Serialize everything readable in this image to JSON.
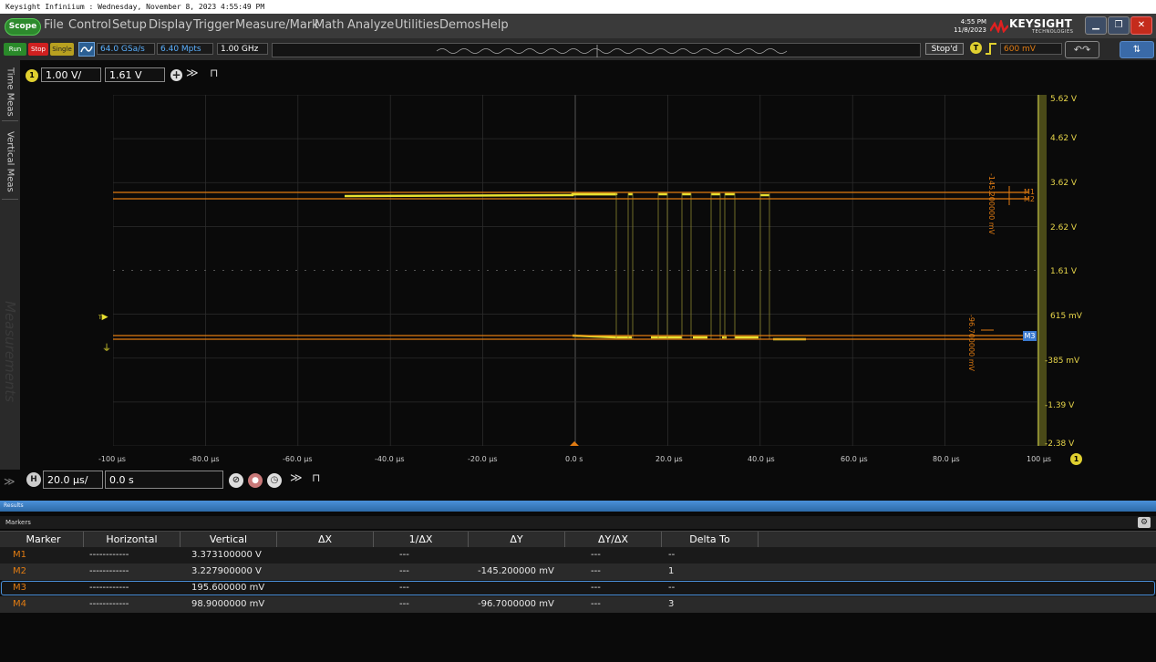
{
  "title_bar": "Keysight Infiniium : Wednesday, November 8, 2023 4:55:49 PM",
  "menu": {
    "scope_label": "Scope",
    "items": [
      "File",
      "Control",
      "Setup",
      "Display",
      "Trigger",
      "Measure/Mark",
      "Math",
      "Analyze",
      "Utilities",
      "Demos",
      "Help"
    ]
  },
  "header_right": {
    "time": "4:55 PM",
    "date": "11/8/2023",
    "brand": "KEYSIGHT",
    "brand_sub": "TECHNOLOGIES"
  },
  "toolbar": {
    "run_label": "Run",
    "stop_label": "Stop",
    "single_label": "Single",
    "sample_rate": "64.0 GSa/s",
    "memory_depth": "6.40 Mpts",
    "bandwidth": "1.00 GHz",
    "status": "Stop'd",
    "trigger_channel": "T",
    "trigger_level": "600 mV"
  },
  "side_tabs": {
    "time_meas": "Time Meas",
    "vertical_meas": "Vertical Meas",
    "measurements": "Measurements"
  },
  "channel1": {
    "number": "1",
    "scale": "1.00 V/",
    "offset": "1.61 V"
  },
  "horizontal": {
    "label": "H",
    "scale": "20.0 µs/",
    "position": "0.0 s"
  },
  "y_axis_labels": [
    "5.62 V",
    "4.62 V",
    "3.62 V",
    "2.62 V",
    "1.61 V",
    "615 mV",
    "-385 mV",
    "-1.39 V",
    "-2.38 V"
  ],
  "x_axis_labels": [
    "-100 µs",
    "-80.0 µs",
    "-60.0 µs",
    "-40.0 µs",
    "-20.0 µs",
    "0.0 s",
    "20.0 µs",
    "40.0 µs",
    "60.0 µs",
    "80.0 µs",
    "100 µs"
  ],
  "marker_tags": {
    "m1": "M1",
    "m2": "M2",
    "m3": "M3",
    "delta_12": "-145.200000 mV",
    "delta_34": "-96.700000 mV",
    "trigger_tag": "T"
  },
  "colors": {
    "trace": "#e8e030",
    "marker": "#e07b12",
    "background": "#0a0a0a",
    "grid": "#2c2c2c",
    "selected_row": "#4a90d9"
  },
  "results": {
    "bar_label": "Results",
    "section_label": "Markers",
    "columns": [
      "Marker",
      "Horizontal",
      "Vertical",
      "ΔX",
      "1/ΔX",
      "ΔY",
      "ΔY/ΔX",
      "Delta To"
    ],
    "rows": [
      {
        "marker": "M1",
        "horizontal": "------------",
        "vertical": "3.373100000 V",
        "dx": "",
        "inv_dx": "---",
        "dy": "",
        "dydx": "---",
        "delta_to": "--"
      },
      {
        "marker": "M2",
        "horizontal": "------------",
        "vertical": "3.227900000 V",
        "dx": "",
        "inv_dx": "---",
        "dy": "-145.200000 mV",
        "dydx": "---",
        "delta_to": "1"
      },
      {
        "marker": "M3",
        "horizontal": "------------",
        "vertical": "195.600000 mV",
        "dx": "",
        "inv_dx": "---",
        "dy": "",
        "dydx": "---",
        "delta_to": "--"
      },
      {
        "marker": "M4",
        "horizontal": "------------",
        "vertical": "98.9000000 mV",
        "dx": "",
        "inv_dx": "---",
        "dy": "-96.7000000 mV",
        "dydx": "---",
        "delta_to": "3"
      }
    ],
    "selected_row": 2
  }
}
